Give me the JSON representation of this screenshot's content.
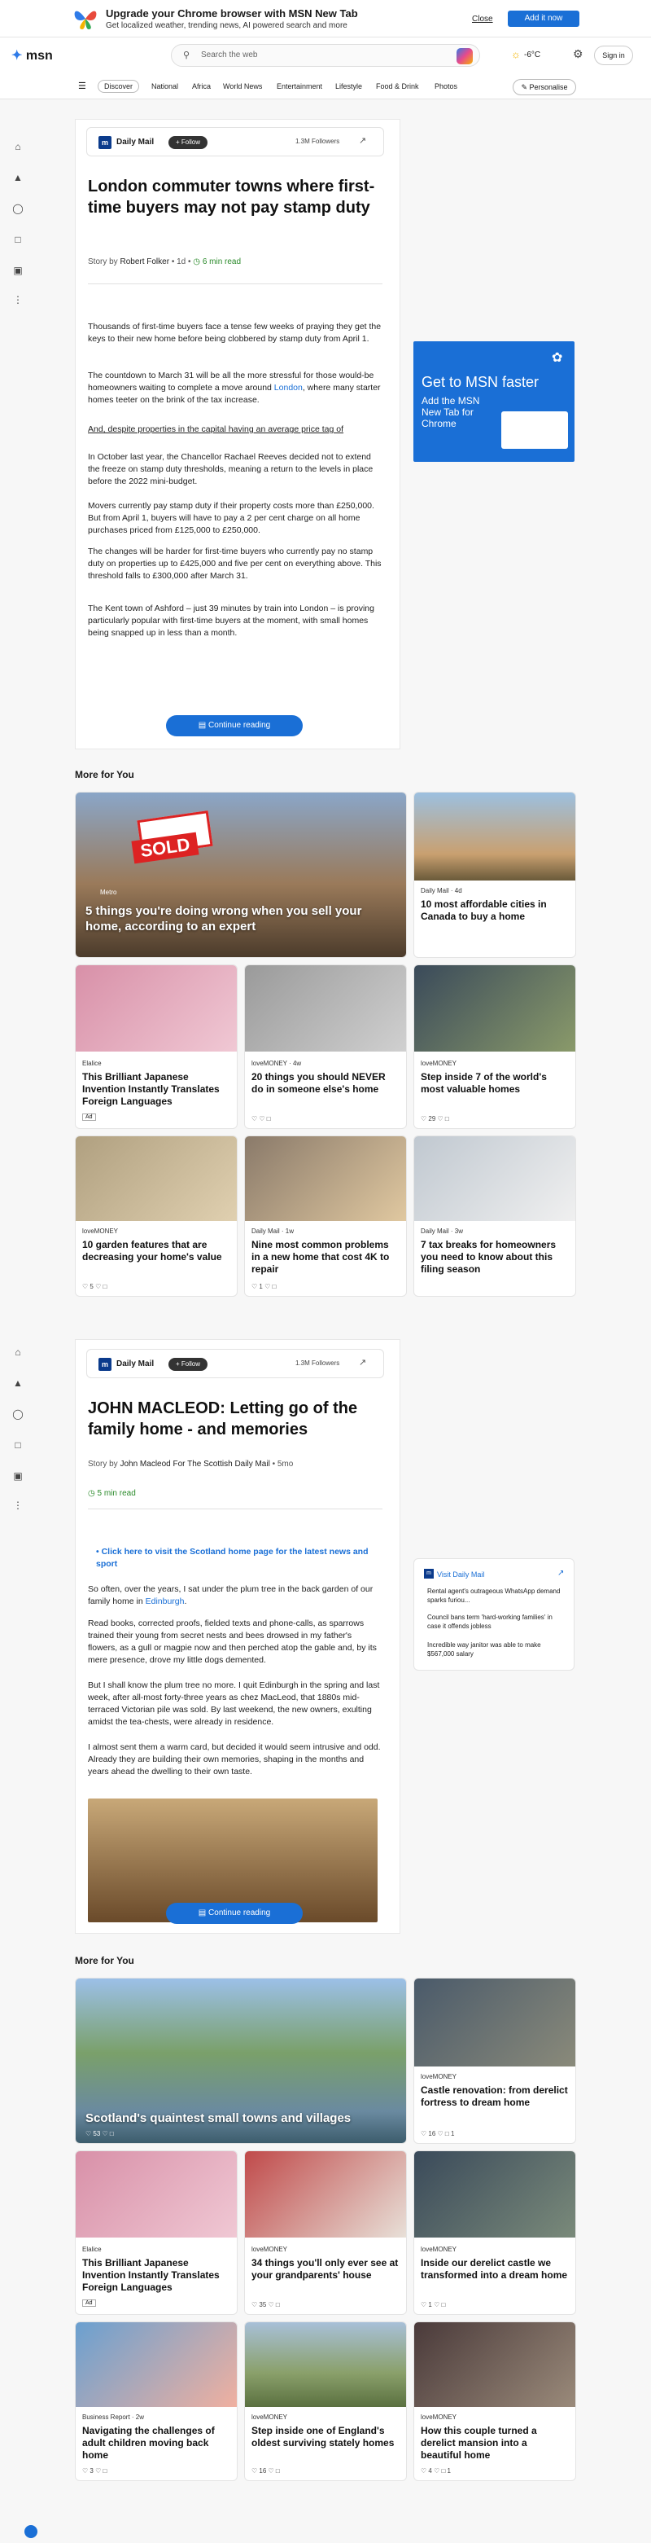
{
  "banner": {
    "title": "Upgrade your Chrome browser with MSN New Tab",
    "subtitle": "Get localized weather, trending news, AI powered search and more",
    "close": "Close",
    "add": "Add it now"
  },
  "header": {
    "logo": "msn",
    "search_placeholder": "Search the web",
    "weather": "-6°C",
    "signin": "Sign in"
  },
  "nav": {
    "items": [
      "Discover",
      "National",
      "Africa",
      "World News",
      "Entertainment",
      "Lifestyle",
      "Food & Drink",
      "Photos"
    ],
    "personalise": "Personalise"
  },
  "article1": {
    "publisher": "Daily Mail",
    "follow": "Follow",
    "followers": "1.3M Followers",
    "title": "London commuter towns where first-time buyers may not pay stamp duty",
    "story_by": "Story by",
    "author": "Robert Folker",
    "age": "1d",
    "read_time": "6 min read",
    "p1": "Thousands of first-time buyers face a tense few weeks of praying they get the keys to their new home before being clobbered by stamp duty from April 1.",
    "p2a": "The countdown to March 31 will be all the more stressful for those would-be homeowners waiting to complete a move around ",
    "p2link": "London",
    "p2b": ", where many starter homes teeter on the brink of the tax increase.",
    "p3": "And, despite properties in the capital having an average price tag of",
    "p4": "In October last year, the Chancellor Rachael Reeves decided not to extend the freeze on stamp duty thresholds, meaning a return to the levels in place before the 2022 mini-budget.",
    "p5": "Movers currently pay stamp duty if their property costs more than £250,000. But from April 1, buyers will have to pay a 2 per cent charge on all home purchases priced from £125,000 to £250,000.",
    "p6": "The changes will be harder for first-time buyers who currently pay no stamp duty on properties up to £425,000 and five per cent on everything above. This threshold falls to £300,000 after March 31.",
    "p7": "The Kent town of Ashford – just 39 minutes by train into London – is proving particularly popular with first-time buyers at the moment, with small homes being snapped up in less than a month.",
    "continue": "Continue reading"
  },
  "ad": {
    "headline": "Get to MSN faster",
    "sub": "Add the MSN New Tab for Chrome"
  },
  "more1": {
    "title": "More for You",
    "hero": {
      "source": "Metro",
      "title": "5 things you're doing wrong when you sell your home, according to an expert"
    },
    "c1": {
      "source": "Daily Mail · 4d",
      "title": "10 most affordable cities in Canada to buy a home"
    },
    "c2": {
      "source": "Elalice",
      "title": "This Brilliant Japanese Invention Instantly Translates Foreign Languages",
      "badge": "Ad"
    },
    "c3": {
      "source": "loveMONEY · 4w",
      "title": "20 things you should NEVER do in someone else's home"
    },
    "c4": {
      "source": "loveMONEY",
      "title": "Step inside 7 of the world's most valuable homes",
      "reacts": "29"
    },
    "c5": {
      "source": "loveMONEY",
      "title": "10 garden features that are decreasing your home's value",
      "reacts": "5"
    },
    "c6": {
      "source": "Daily Mail · 1w",
      "title": "Nine most common problems in a new home that cost 4K to repair",
      "reacts": "1"
    },
    "c7": {
      "source": "Daily Mail · 3w",
      "title": "7 tax breaks for homeowners you need to know about this filing season"
    }
  },
  "article2": {
    "publisher": "Daily Mail",
    "follow": "Follow",
    "followers": "1.3M Followers",
    "title": "JOHN MACLEOD: Letting go of the family home - and memories",
    "story_by": "Story by",
    "author": "John Macleod For The Scottish Daily Mail",
    "age": "5mo",
    "read_time": "5 min read",
    "link": "Click here to visit the Scotland home page for the latest news and sport",
    "p1a": "So often, over the years, I sat under the plum tree in the back garden of our family home in ",
    "p1link": "Edinburgh",
    "p1b": ".",
    "p2": "Read books, corrected proofs, fielded texts and phone-calls, as sparrows trained their young from secret nests and bees drowsed in my father's flowers, as a gull or magpie now and then perched atop the gable and, by its mere presence, drove my little dogs demented.",
    "p3": "But I shall know the plum tree no more. I quit Edinburgh in the spring and last week, after all-most forty-three years as chez MacLeod, that 1880s mid-terraced Victorian pile was sold. By last weekend, the new owners, exulting amidst the tea-chests, were already in residence.",
    "p4": "I almost sent them a warm card, but decided it would seem intrusive and odd. Already they are building their own memories, shaping in the months and years ahead the dwelling to their own taste.",
    "continue": "Continue reading"
  },
  "visit": {
    "title": "Visit Daily Mail",
    "items": [
      "Rental agent's outrageous WhatsApp demand sparks furiou...",
      "Council bans term 'hard-working families' in case it offends jobless",
      "Incredible way janitor was able to make $567,000 salary"
    ]
  },
  "more2": {
    "title": "More for You",
    "hero": {
      "title": "Scotland's quaintest small towns and villages",
      "reacts": "53"
    },
    "c1": {
      "source": "loveMONEY",
      "title": "Castle renovation: from derelict fortress to dream home",
      "reacts": "16",
      "comments": "1"
    },
    "c2": {
      "source": "Elalice",
      "title": "This Brilliant Japanese Invention Instantly Translates Foreign Languages",
      "badge": "Ad"
    },
    "c3": {
      "source": "loveMONEY",
      "title": "34 things you'll only ever see at your grandparents' house",
      "reacts": "35"
    },
    "c4": {
      "source": "loveMONEY",
      "title": "Inside our derelict castle we transformed into a dream home",
      "reacts": "1"
    },
    "c5": {
      "source": "Business Report · 2w",
      "title": "Navigating the challenges of adult children moving back home",
      "reacts": "3"
    },
    "c6": {
      "source": "loveMONEY",
      "title": "Step inside one of England's oldest surviving stately homes",
      "reacts": "16"
    },
    "c7": {
      "source": "loveMONEY",
      "title": "How this couple turned a derelict mansion into a beautiful home",
      "reacts": "4",
      "comments": "1"
    }
  },
  "colors": {
    "accent": "#1a6fd6",
    "green": "#2a8a2a"
  }
}
